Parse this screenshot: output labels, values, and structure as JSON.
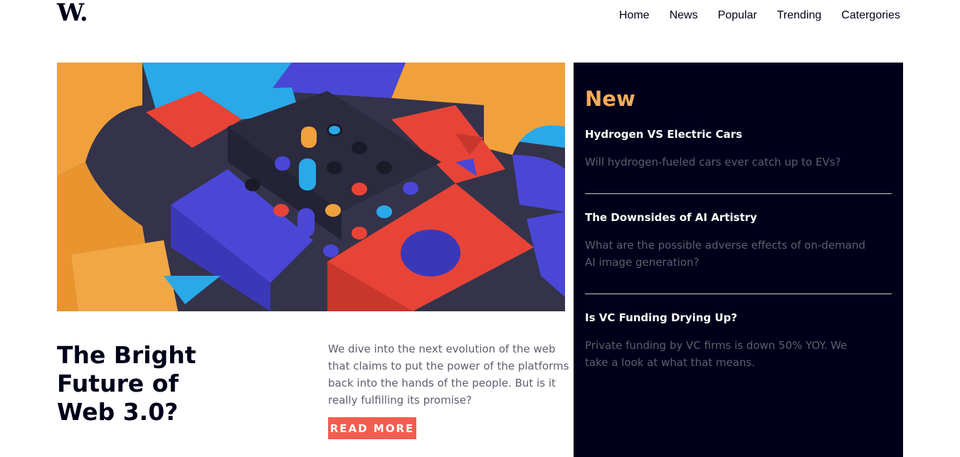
{
  "header": {
    "logo": "W.",
    "nav": [
      "Home",
      "News",
      "Popular",
      "Trending",
      "Catergories"
    ]
  },
  "feature": {
    "title": "The Bright Future of Web 3.0?",
    "summary": "We dive into the next evolution of the web that claims to put the power of the platforms back into the hands of the people. But is it really fulfilling its promise?",
    "cta": "READ MORE"
  },
  "new_panel": {
    "title": "New",
    "items": [
      {
        "title": "Hydrogen VS Electric Cars",
        "summary": "Will hydrogen-fueled cars ever catch up to EVs?"
      },
      {
        "title": "The Downsides of AI Artistry",
        "summary": "What are the possible adverse effects of on-demand AI image generation?"
      },
      {
        "title": "Is VC Funding Drying Up?",
        "summary": "Private funding by VC firms is down 50% YOY. We take a look at what that means."
      }
    ]
  },
  "colors": {
    "navy": "#00001a",
    "orange_accent": "#f5ab5d",
    "cta_red": "#f15e50",
    "muted_text": "#5d5f6d"
  }
}
